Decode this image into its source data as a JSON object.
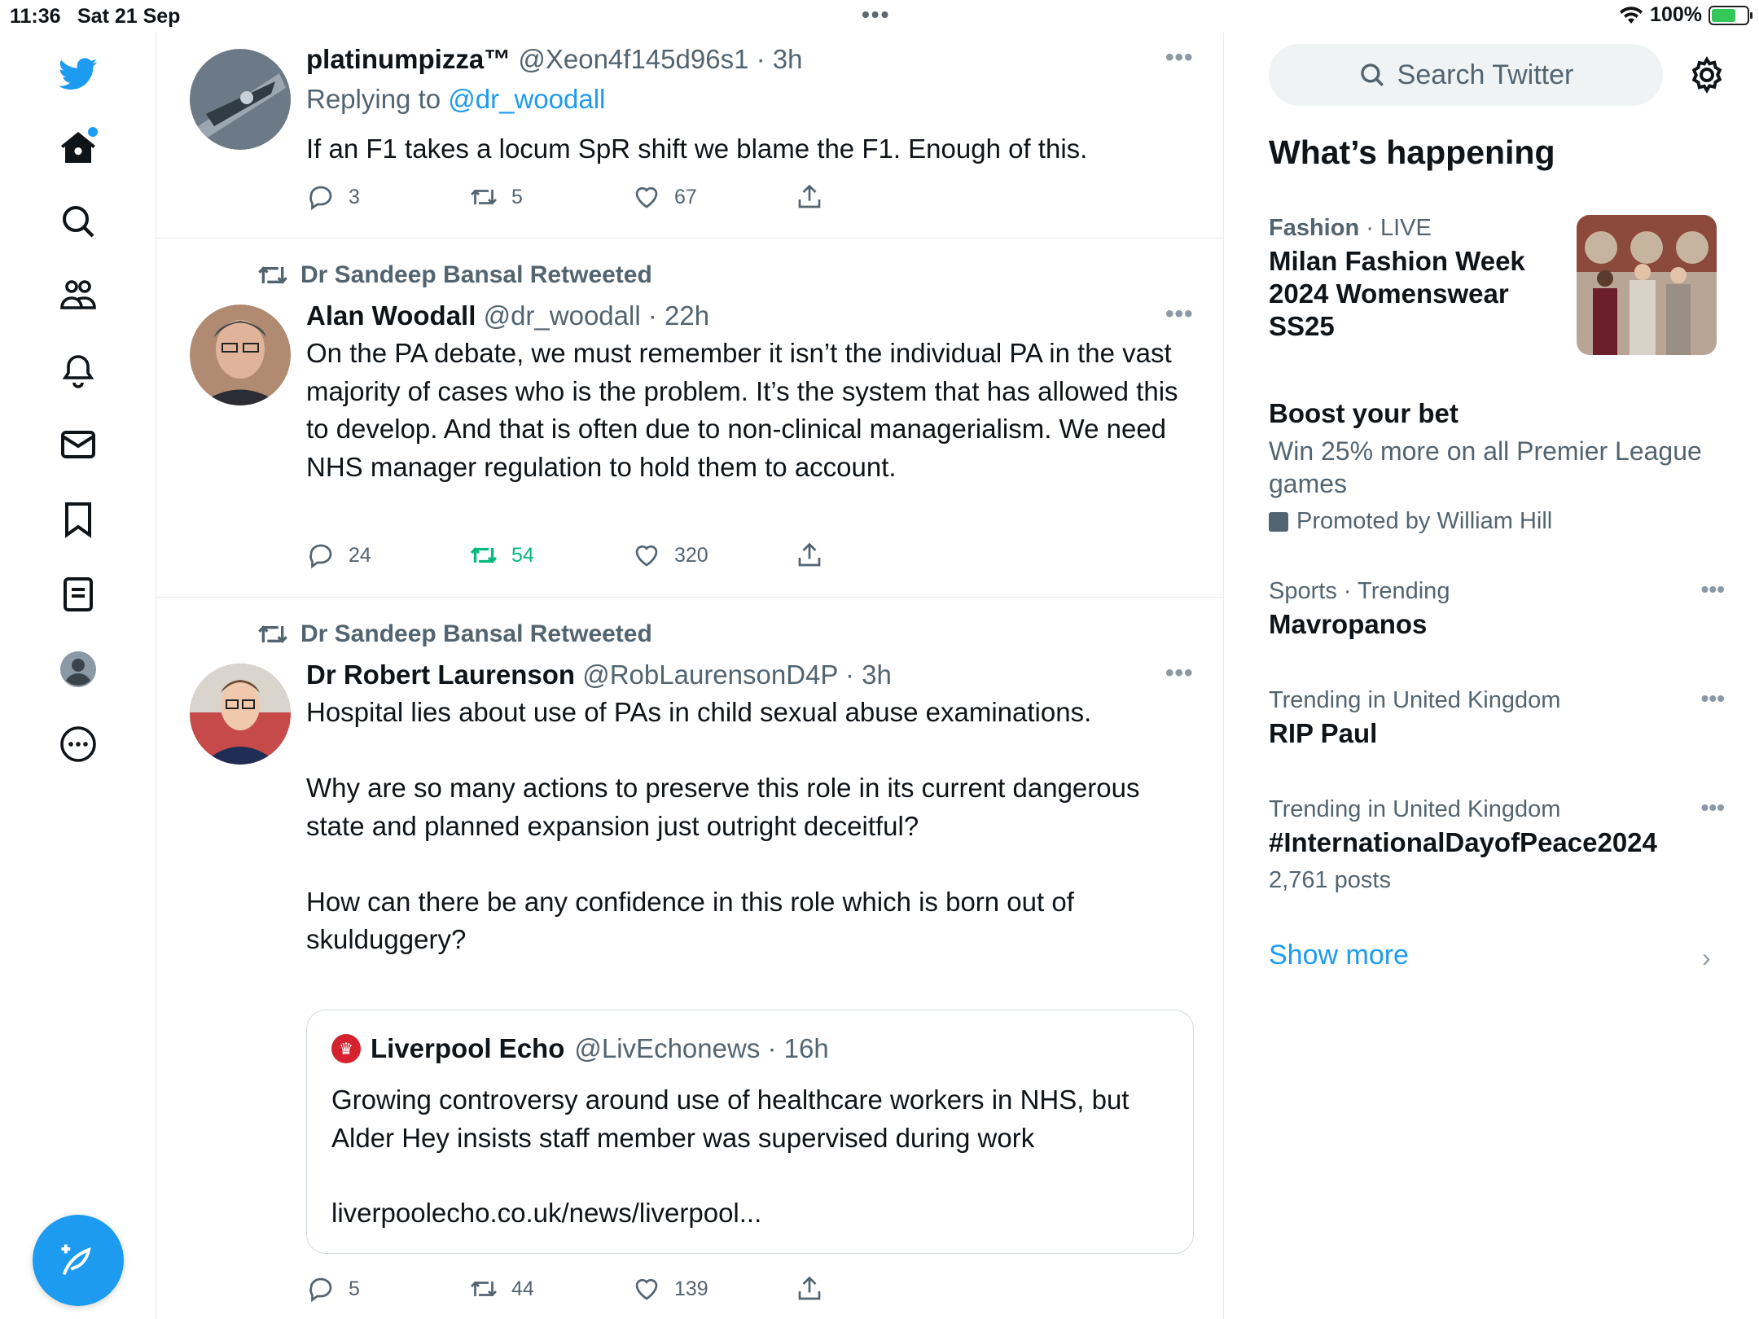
{
  "status_bar": {
    "time": "11:36",
    "date": "Sat 21 Sep",
    "battery": "100%"
  },
  "nav": {
    "items": [
      "home-icon",
      "search-icon",
      "communities-icon",
      "notifications-icon",
      "messages-icon",
      "bookmarks-icon",
      "lists-icon",
      "profile-icon",
      "more-icon"
    ]
  },
  "tweets": [
    {
      "name": "platinumpizza™",
      "handle": "@Xeon4f145d96s1 · 3h",
      "replying_label": "Replying to ",
      "replying_to": "@dr_woodall",
      "text": "If an F1 takes a locum SpR shift we blame the F1. Enough of this.",
      "replies": "3",
      "retweets": "5",
      "likes": "67"
    },
    {
      "retweeted_by": "Dr Sandeep Bansal Retweeted",
      "name": "Alan Woodall",
      "handle": "@dr_woodall · 22h",
      "text": "On the PA debate, we must remember it isn’t the individual PA in the vast majority of cases who is the problem. It’s the system that has allowed this to develop. And that is often due to non-clinical managerialism. We need NHS manager regulation to hold them to account.",
      "replies": "24",
      "retweets": "54",
      "likes": "320"
    },
    {
      "retweeted_by": "Dr Sandeep Bansal Retweeted",
      "name": "Dr Robert Laurenson",
      "handle": "@RobLaurensonD4P · 3h",
      "text": "Hospital lies about use of PAs in child sexual abuse examinations.\n\nWhy are so many actions to preserve this role in its current dangerous state and planned expansion just outright deceitful?\n\nHow can there be any confidence in this role which is born out of skulduggery?",
      "quote": {
        "name": "Liverpool Echo",
        "handle": "@LivEchonews · 16h",
        "text": "Growing controversy around use of healthcare workers in NHS, but Alder Hey insists staff member was supervised during work",
        "link": "liverpoolecho.co.uk/news/liverpool..."
      },
      "replies": "5",
      "retweets": "44",
      "likes": "139"
    }
  ],
  "sidebar": {
    "search_placeholder": "Search Twitter",
    "heading": "What’s happening",
    "trends": [
      {
        "category": "Fashion",
        "sep": " · ",
        "extra": "LIVE",
        "title": "Milan Fashion Week 2024 Womenswear SS25"
      },
      {
        "title": "Boost your bet",
        "sub": "Win 25% more on all Premier League games",
        "promo": "Promoted by William Hill"
      },
      {
        "category": "Sports · Trending",
        "title": "Mavropanos"
      },
      {
        "category": "Trending in United Kingdom",
        "title": "RIP Paul"
      },
      {
        "category": "Trending in United Kingdom",
        "title": "#InternationalDayofPeace2024",
        "sub": "2,761 posts"
      }
    ],
    "show_more": "Show more"
  },
  "colors": {
    "accent": "#1d9bf0",
    "retweet_green": "#00ba7c",
    "secondary_text": "#536471"
  }
}
